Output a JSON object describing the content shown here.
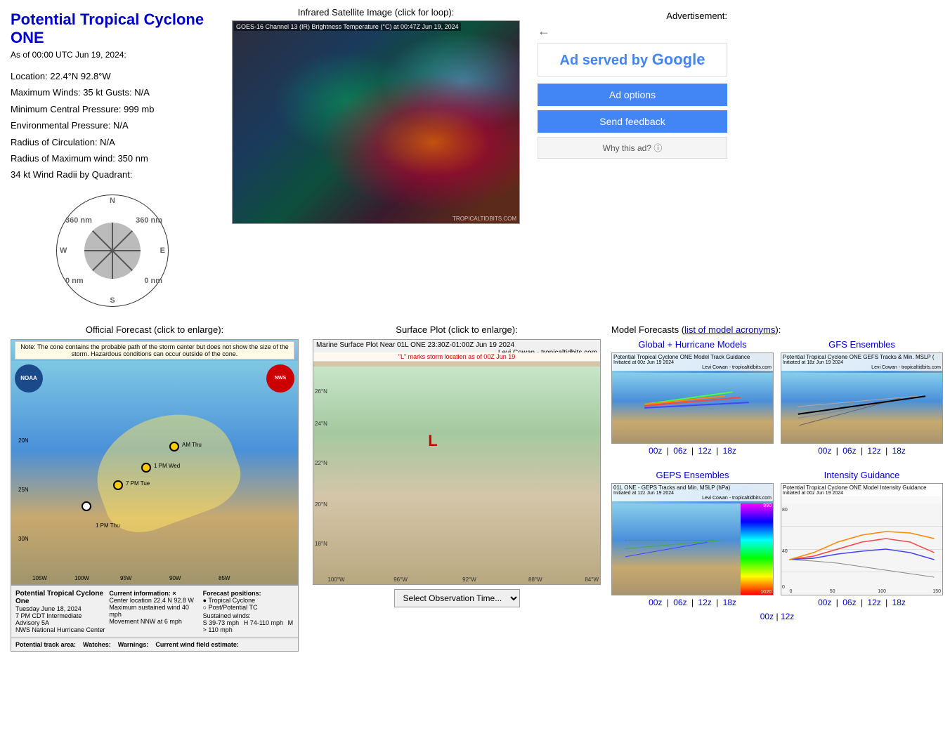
{
  "header": {
    "title": "Potential Tropical Cyclone ONE",
    "as_of": "As of 00:00 UTC Jun 19, 2024:"
  },
  "storm_info": {
    "location": "Location: 22.4°N 92.8°W",
    "max_winds": "Maximum Winds: 35 kt  Gusts: N/A",
    "min_pressure": "Minimum Central Pressure: 999 mb",
    "env_pressure": "Environmental Pressure: N/A",
    "radius_circulation": "Radius of Circulation: N/A",
    "radius_max_wind": "Radius of Maximum wind: 350 nm",
    "wind_radii_label": "34 kt Wind Radii by Quadrant:"
  },
  "compass": {
    "nw": "360 nm",
    "ne": "360 nm",
    "sw": "0 nm",
    "se": "0 nm",
    "n": "N",
    "s": "S",
    "e": "E",
    "w": "W"
  },
  "satellite": {
    "title": "Infrared Satellite Image (click for loop):",
    "img_label": "GOES-16 Channel 13 (IR) Brightness Temperature (°C) at 00:47Z Jun 19, 2024",
    "watermark": "TROPICALTIDBITS.COM"
  },
  "ad": {
    "label": "Advertisement:",
    "served_by": "Ad served by",
    "google": "Google",
    "options_label": "Ad options",
    "feedback_label": "Send feedback",
    "why_label": "Why this ad? ⓘ"
  },
  "forecast": {
    "title": "Official Forecast (click to enlarge):",
    "note": "Note: The cone contains the probable path of the storm center but does not show the size of the storm. Hazardous conditions can occur outside of the cone.",
    "storm_name": "Potential Tropical Cyclone One",
    "date": "Tuesday June 18, 2024",
    "time": "7 PM CDT Intermediate Advisory 5A",
    "nhc": "NWS National Hurricane Center",
    "current_info_label": "Current information: ×",
    "center_location": "Center location 22.4 N 92.8 W",
    "max_sustained": "Maximum sustained wind 40 mph",
    "movement": "Movement NNW at 6 mph",
    "forecast_positions": "Forecast positions:",
    "tropical_cyclone": "● Tropical Cyclone",
    "post_tc": "○ Post/Potential TC",
    "sustained_winds_label": "Sustained winds:",
    "s_range": "S 39-73 mph",
    "h_range": "H 74-110 mph",
    "m_range": "M > 110 mph",
    "track_area_label": "Potential track area:",
    "watches_label": "Watches:",
    "warnings_label": "Warnings:",
    "wind_field_label": "Current wind field estimate:"
  },
  "surface": {
    "title": "Surface Plot (click to enlarge):",
    "main_label": "Marine Surface Plot Near 01L ONE 23:30Z-01:00Z Jun 19 2024",
    "sub_label": "\"L\" marks storm location as of 00Z Jun 19",
    "credit": "Levi Cowan - tropicaltidbits.com",
    "select_label": "Select Observation Time..."
  },
  "models": {
    "title": "Model Forecasts (",
    "acronyms_link": "list of model acronyms",
    "title_end": "):",
    "global_hurricane_title": "Global + Hurricane Models",
    "gfs_ensembles_title": "GFS Ensembles",
    "geps_ensembles_title": "GEPS Ensembles",
    "intensity_title": "Intensity Guidance",
    "global_img_label": "Potential Tropical Cyclone ONE Model Track Guidance",
    "global_img_sublabel": "Initiated at 00z Jun 19 2024",
    "gfs_img_label": "Potential Tropical Cyclone ONE GEFS Tracks & Min. MSLP (",
    "gfs_img_sublabel": "Initiated at 18z Jun 19 2024",
    "geps_img_label": "01L ONE - GEPS Tracks and Min. MSLP (hPa)",
    "geps_img_sublabel": "Initiated at 12z Jun 19 2024",
    "intensity_img_label": "Potential Tropical Cyclone ONE Model Intensity Guidance",
    "intensity_img_sublabel": "Initiated at 00z Jun 19 2024",
    "credit": "Levi Cowan - tropicaltidbits.com",
    "links_00z": "00z",
    "links_06z": "06z",
    "links_12z": "12z",
    "links_18z": "18z",
    "sep": "|",
    "bottom_links_00z": "00z",
    "bottom_links_12z": "12z"
  }
}
